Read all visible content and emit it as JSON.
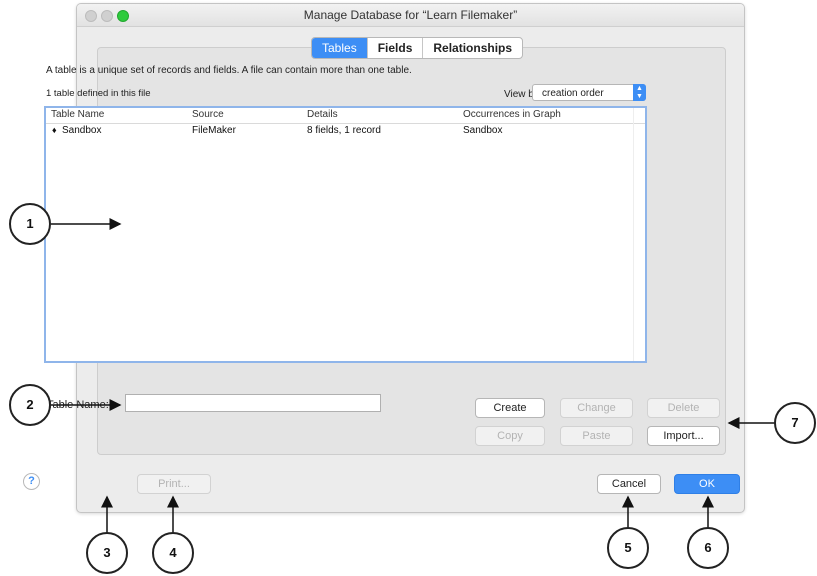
{
  "window": {
    "title": "Manage Database for “Learn Filemaker”"
  },
  "tabs": [
    {
      "label": "Tables",
      "active": true
    },
    {
      "label": "Fields",
      "active": false
    },
    {
      "label": "Relationships",
      "active": false
    }
  ],
  "description": "A table is a unique set of records and fields. A file can contain more than one table.",
  "table_count": "1 table defined in this file",
  "view_by": {
    "label": "View by:",
    "value": "creation order"
  },
  "table_list": {
    "columns": [
      "Table Name",
      "Source",
      "Details",
      "Occurrences in Graph"
    ],
    "rows": [
      {
        "name": "Sandbox",
        "source": "FileMaker",
        "details": "8 fields, 1 record",
        "occurrences": "Sandbox"
      }
    ]
  },
  "table_name_field": {
    "label": "Table Name:",
    "value": ""
  },
  "buttons": {
    "create": "Create",
    "change": "Change",
    "delete": "Delete",
    "copy": "Copy",
    "paste": "Paste",
    "import": "Import...",
    "print": "Print...",
    "cancel": "Cancel",
    "ok": "OK",
    "help": "?"
  },
  "callouts": [
    "1",
    "2",
    "3",
    "4",
    "5",
    "6",
    "7"
  ],
  "colors": {
    "accent": "#3d8ef5",
    "window_bg": "#ececec",
    "list_border": "#8fb5ea",
    "zoom_button": "#2ecb3d"
  }
}
